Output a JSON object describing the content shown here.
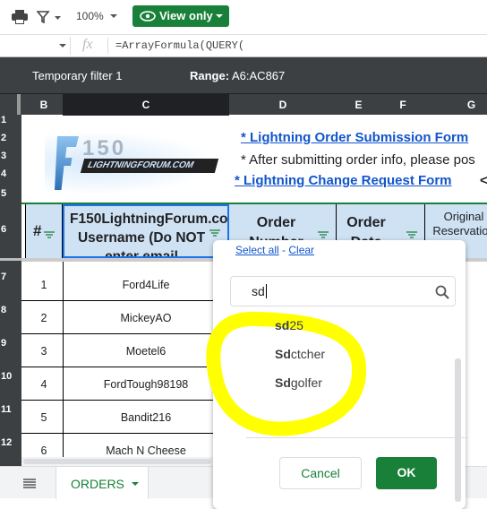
{
  "toolbar": {
    "zoom": "100%",
    "view_only": "View only",
    "icons": [
      "print-icon",
      "filter-icon",
      "eye-icon"
    ]
  },
  "formula_bar": {
    "fx": "fx",
    "formula": "=ArrayFormula(QUERY("
  },
  "filter_bar": {
    "name": "Temporary filter 1",
    "range_label": "Range:",
    "range": "A6:AC867"
  },
  "columns": [
    "B",
    "C",
    "D",
    "E",
    "F",
    "G"
  ],
  "row_numbers": [
    "1",
    "2",
    "3",
    "4",
    "5",
    "6",
    "7",
    "8",
    "9",
    "10",
    "11",
    "12"
  ],
  "banner": {
    "logo_text": "F150 LIGHTNINGFORUM.COM",
    "link1": "* Lightning Order Submission Form",
    "note": "* After submitting order info, please pos",
    "link2": "* Lightning Change Request Form",
    "trail": "<"
  },
  "headers": [
    "#",
    "F150LightningForum.com Username (Do NOT enter email",
    "Order Number",
    "Order Date",
    "Original Reservation"
  ],
  "rows": [
    {
      "n": "1",
      "user": "Ford4Life"
    },
    {
      "n": "2",
      "user": "MickeyAO"
    },
    {
      "n": "3",
      "user": "Moetel6"
    },
    {
      "n": "4",
      "user": "FordTough98198"
    },
    {
      "n": "5",
      "user": "Bandit216"
    },
    {
      "n": "6",
      "user": "Mach N Cheese"
    }
  ],
  "filter_dialog": {
    "select_all": "Select all",
    "sep": " - ",
    "clear": "Clear",
    "search_value": "sd",
    "items": [
      {
        "bold": "sd",
        "rest": "25"
      },
      {
        "bold": "Sd",
        "rest": "ctcher"
      },
      {
        "bold": "Sd",
        "rest": "golfer"
      }
    ],
    "cancel": "Cancel",
    "ok": "OK",
    "highlight_color": "#ffff00"
  },
  "sheet_tab": {
    "label": "ORDERS"
  },
  "colors": {
    "accent": "#188038",
    "header_fill": "#cfe2f3",
    "link": "#1155cc"
  }
}
